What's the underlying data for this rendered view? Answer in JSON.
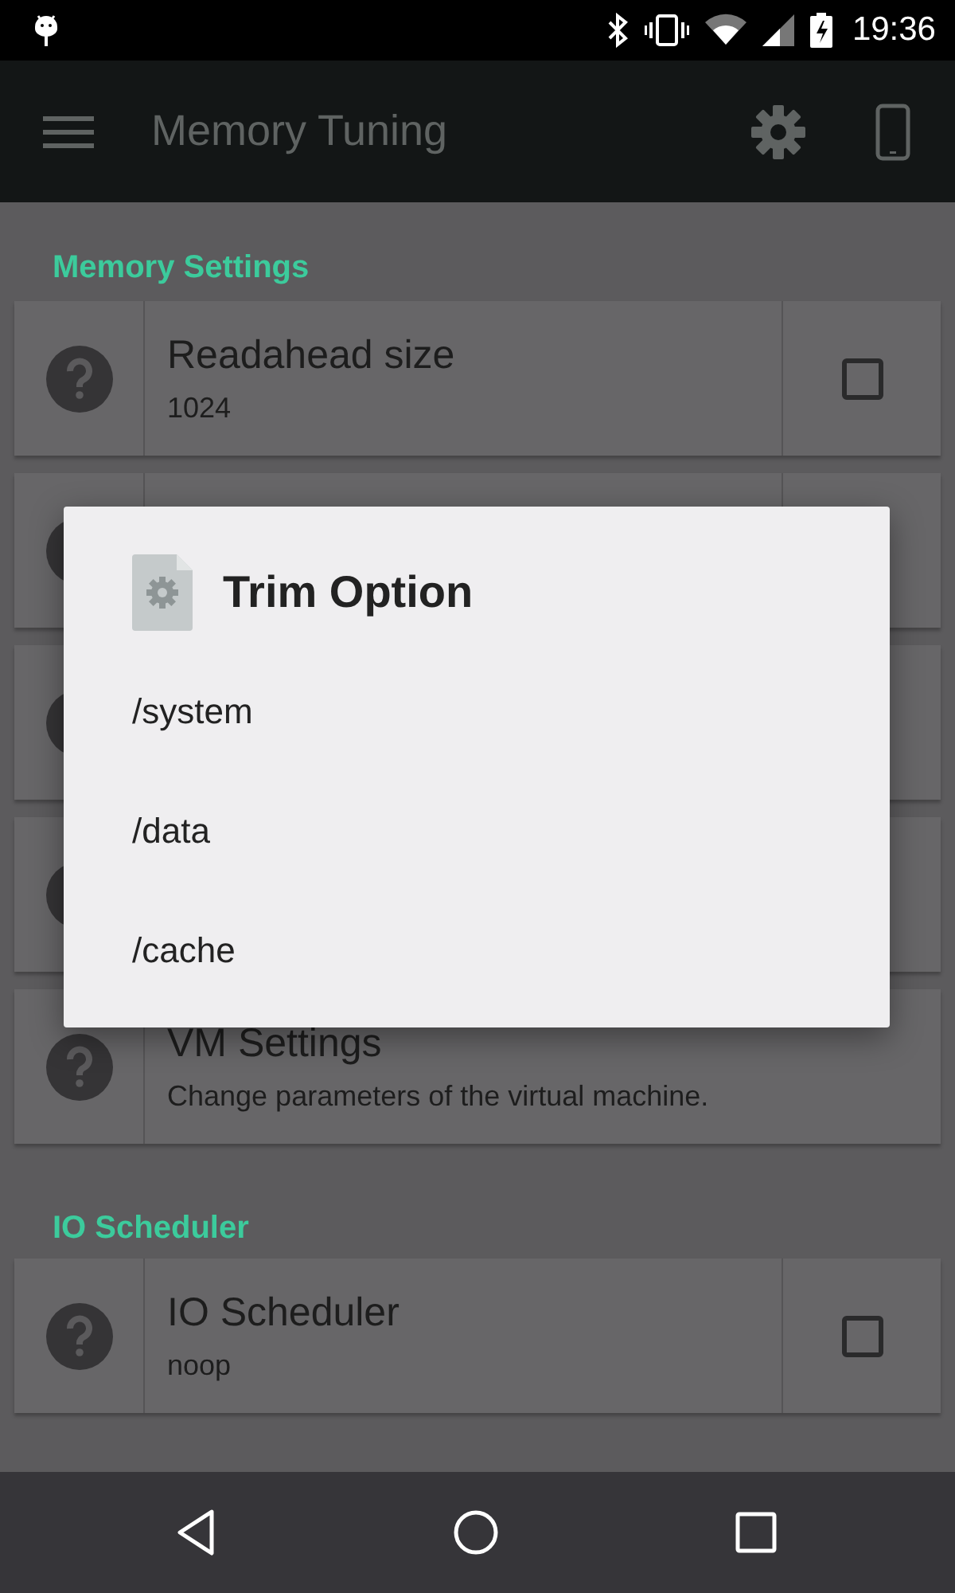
{
  "status_bar": {
    "time": "19:36"
  },
  "toolbar": {
    "title": "Memory Tuning"
  },
  "sections": [
    {
      "header": "Memory Settings",
      "rows": [
        {
          "kind": "checkbox",
          "title": "Readahead size",
          "summary": "1024",
          "checked": false
        },
        {
          "kind": "split"
        },
        {
          "kind": "plain"
        },
        {
          "kind": "plain"
        },
        {
          "kind": "plain",
          "title": "VM Settings",
          "summary": "Change parameters of the virtual machine."
        }
      ]
    },
    {
      "header": "IO Scheduler",
      "rows": [
        {
          "kind": "checkbox",
          "title": "IO Scheduler",
          "summary": "noop",
          "checked": false
        }
      ]
    }
  ],
  "dialog": {
    "title": "Trim Option",
    "items": [
      "/system",
      "/data",
      "/cache"
    ]
  }
}
